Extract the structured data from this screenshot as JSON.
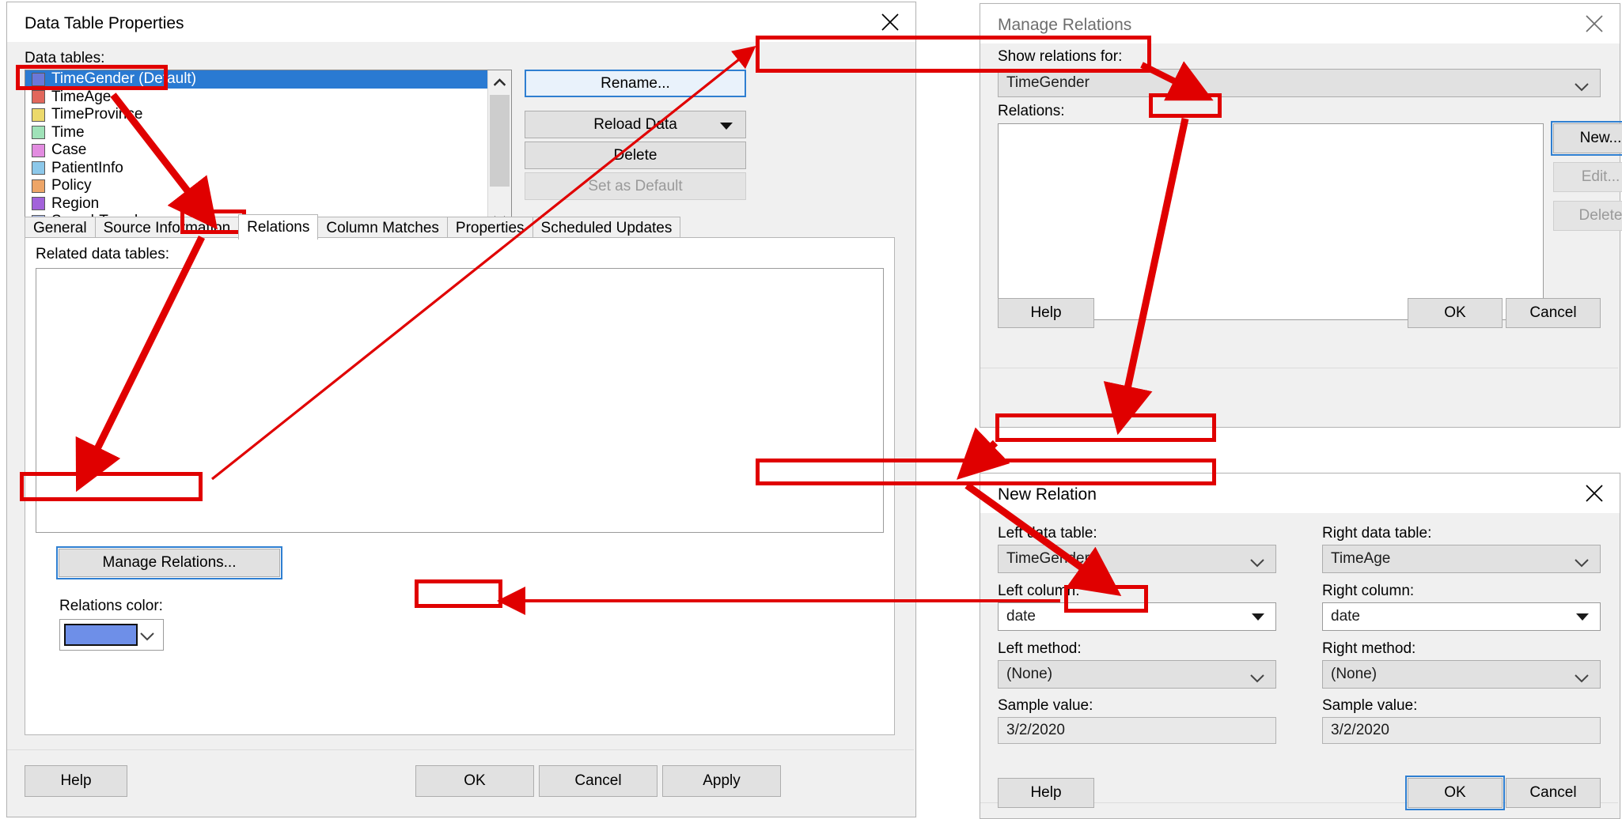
{
  "dialog1": {
    "title": "Data Table Properties",
    "close_icon": "close-icon",
    "data_tables_label": "Data tables:",
    "tables": [
      {
        "name": "TimeGender (Default)",
        "color": "#6b78d8",
        "selected": true
      },
      {
        "name": "TimeAge",
        "color": "#e2675c",
        "selected": false
      },
      {
        "name": "TimeProvince",
        "color": "#ecd96b",
        "selected": false
      },
      {
        "name": "Time",
        "color": "#9fe2b8",
        "selected": false
      },
      {
        "name": "Case",
        "color": "#e28ce0",
        "selected": false
      },
      {
        "name": "PatientInfo",
        "color": "#8cc8ea",
        "selected": false
      },
      {
        "name": "Policy",
        "color": "#eda567",
        "selected": false
      },
      {
        "name": "Region",
        "color": "#a262da",
        "selected": false
      },
      {
        "name": "SearchTrend",
        "color": "#a9bdf0",
        "selected": false
      }
    ],
    "buttons": {
      "rename": "Rename...",
      "reload_data": "Reload Data",
      "delete": "Delete",
      "set_as_default": "Set as Default"
    },
    "tabs": [
      {
        "label": "General",
        "active": false
      },
      {
        "label": "Source Information",
        "active": false
      },
      {
        "label": "Relations",
        "active": true
      },
      {
        "label": "Column Matches",
        "active": false
      },
      {
        "label": "Properties",
        "active": false
      },
      {
        "label": "Scheduled Updates",
        "active": false
      }
    ],
    "related_label": "Related data tables:",
    "manage_relations": "Manage Relations...",
    "relations_color_label": "Relations color:",
    "relations_color_value": "#6e8fe8",
    "footer": {
      "help": "Help",
      "ok": "OK",
      "cancel": "Cancel",
      "apply": "Apply"
    }
  },
  "dialog2": {
    "title": "Manage Relations",
    "close_icon": "close-icon",
    "show_relations_for_label": "Show relations for:",
    "show_relations_for_value": "TimeGender",
    "relations_label": "Relations:",
    "relations_items": [],
    "buttons": {
      "new": "New...",
      "edit": "Edit...",
      "delete": "Delete"
    },
    "footer": {
      "help": "Help",
      "ok": "OK",
      "cancel": "Cancel"
    }
  },
  "dialog3": {
    "title": "New Relation",
    "close_icon": "close-icon",
    "fields": {
      "left_data_table_label": "Left data table:",
      "left_data_table_value": "TimeGender",
      "right_data_table_label": "Right data table:",
      "right_data_table_value": "TimeAge",
      "left_column_label": "Left column:",
      "left_column_value": "date",
      "right_column_label": "Right column:",
      "right_column_value": "date",
      "left_method_label": "Left method:",
      "left_method_value": "(None)",
      "right_method_label": "Right method:",
      "right_method_value": "(None)",
      "left_sample_label": "Sample value:",
      "left_sample_value": "3/2/2020",
      "right_sample_label": "Sample value:",
      "right_sample_value": "3/2/2020"
    },
    "footer": {
      "help": "Help",
      "ok": "OK",
      "cancel": "Cancel"
    }
  },
  "annotation": {
    "color": "#e00000"
  }
}
